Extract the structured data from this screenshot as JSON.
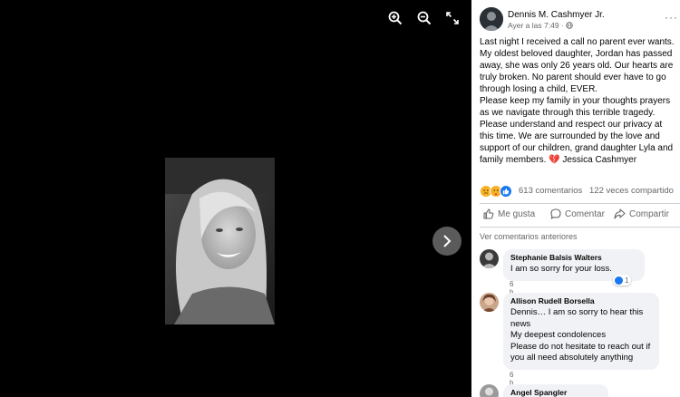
{
  "viewer": {
    "tools": [
      {
        "name": "zoom-in-icon"
      },
      {
        "name": "zoom-out-icon"
      },
      {
        "name": "fullscreen-icon"
      }
    ],
    "next_icon": "chevron-right-icon"
  },
  "post": {
    "author": "Dennis M. Cashmyer Jr.",
    "timestamp": "Ayer a las 7:49",
    "separator": "·",
    "audience_icon": "globe-icon",
    "paragraph1": "Last night I received a call no parent ever wants. My oldest beloved daughter, Jordan has passed away, she was only 26 years old. Our hearts are truly broken. No parent should ever have to go through losing a child, EVER.",
    "paragraph2_main": "Please keep my family in your thoughts prayers as we navigate through this terrible tragedy. Please understand and respect our privacy at this time. We are surrounded by the love and support of our children, grand daughter Lyla and family members.",
    "heart_emoji": "💔",
    "signature": "Jessica Cashmyer"
  },
  "stats": {
    "reactions": [
      {
        "name": "sad-reaction-icon",
        "color": "#f7b125"
      },
      {
        "name": "care-reaction-icon",
        "color": "#f7b125"
      },
      {
        "name": "like-reaction-icon",
        "color": "#1877f2"
      }
    ],
    "comments": "613 comentarios",
    "shares": "122 veces compartido"
  },
  "actions": {
    "like": "Me gusta",
    "comment": "Comentar",
    "share": "Compartir"
  },
  "comments_section": {
    "previous_label": "Ver comentarios anteriores",
    "comments": [
      {
        "name": "Stephanie Balsis Walters",
        "lines": [
          "I am so sorry for your loss."
        ],
        "time": "6 h",
        "likes": "1"
      },
      {
        "name": "Allison Rudell Borsella",
        "lines": [
          "Dennis… I am so sorry to hear this news",
          "My deepest condolences",
          "Please do not hesitate to reach out if you all need absolutely anything"
        ],
        "time": "6 h"
      },
      {
        "name": "Angel Spangler"
      }
    ]
  },
  "colors": {
    "link_blue": "#1877f2",
    "heart_red": "#e41e3f",
    "muted_text": "#65676b",
    "bubble_bg": "#f0f2f5"
  }
}
